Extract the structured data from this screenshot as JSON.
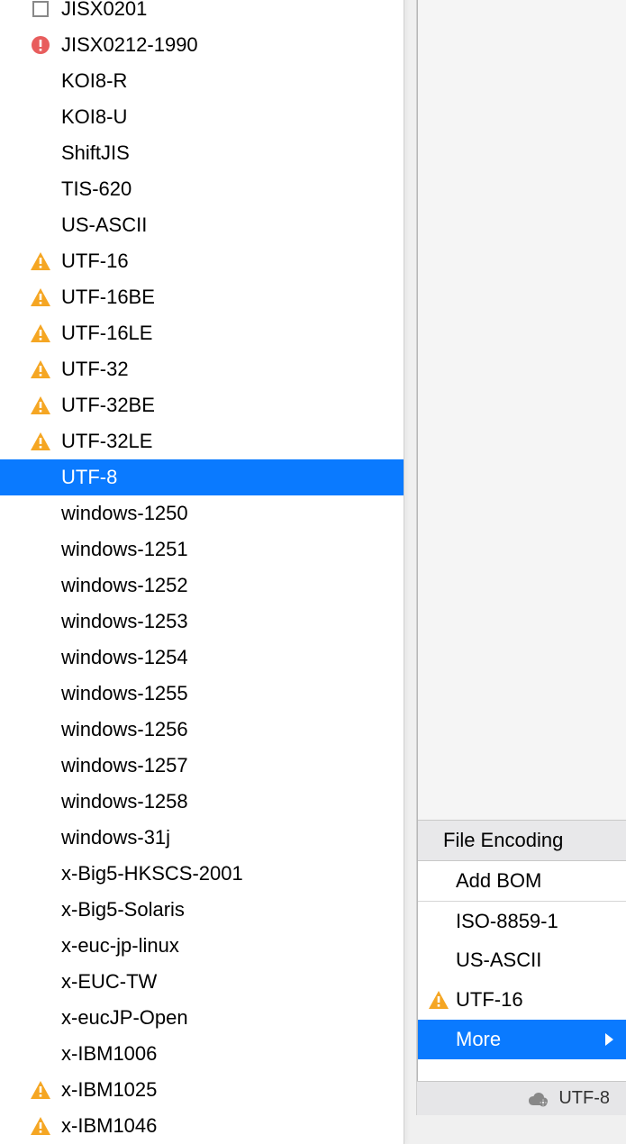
{
  "encoding_menu": {
    "items": [
      {
        "label": "JISX0201",
        "icon": "square"
      },
      {
        "label": "JISX0212-1990",
        "icon": "error"
      },
      {
        "label": "KOI8-R",
        "icon": null
      },
      {
        "label": "KOI8-U",
        "icon": null
      },
      {
        "label": "ShiftJIS",
        "icon": null
      },
      {
        "label": "TIS-620",
        "icon": null
      },
      {
        "label": "US-ASCII",
        "icon": null
      },
      {
        "label": "UTF-16",
        "icon": "warning"
      },
      {
        "label": "UTF-16BE",
        "icon": "warning"
      },
      {
        "label": "UTF-16LE",
        "icon": "warning"
      },
      {
        "label": "UTF-32",
        "icon": "warning"
      },
      {
        "label": "UTF-32BE",
        "icon": "warning"
      },
      {
        "label": "UTF-32LE",
        "icon": "warning"
      },
      {
        "label": "UTF-8",
        "icon": null,
        "selected": true
      },
      {
        "label": "windows-1250",
        "icon": null
      },
      {
        "label": "windows-1251",
        "icon": null
      },
      {
        "label": "windows-1252",
        "icon": null
      },
      {
        "label": "windows-1253",
        "icon": null
      },
      {
        "label": "windows-1254",
        "icon": null
      },
      {
        "label": "windows-1255",
        "icon": null
      },
      {
        "label": "windows-1256",
        "icon": null
      },
      {
        "label": "windows-1257",
        "icon": null
      },
      {
        "label": "windows-1258",
        "icon": null
      },
      {
        "label": "windows-31j",
        "icon": null
      },
      {
        "label": "x-Big5-HKSCS-2001",
        "icon": null
      },
      {
        "label": "x-Big5-Solaris",
        "icon": null
      },
      {
        "label": "x-euc-jp-linux",
        "icon": null
      },
      {
        "label": "x-EUC-TW",
        "icon": null
      },
      {
        "label": "x-eucJP-Open",
        "icon": null
      },
      {
        "label": "x-IBM1006",
        "icon": null
      },
      {
        "label": "x-IBM1025",
        "icon": "warning"
      },
      {
        "label": "x-IBM1046",
        "icon": "warning"
      }
    ]
  },
  "right_panel": {
    "header": "File Encoding",
    "add_bom": "Add BOM",
    "items": [
      {
        "label": "ISO-8859-1",
        "icon": null
      },
      {
        "label": "US-ASCII",
        "icon": null
      },
      {
        "label": "UTF-16",
        "icon": "warning"
      }
    ],
    "more_label": "More"
  },
  "status_bar": {
    "encoding": "UTF-8"
  }
}
